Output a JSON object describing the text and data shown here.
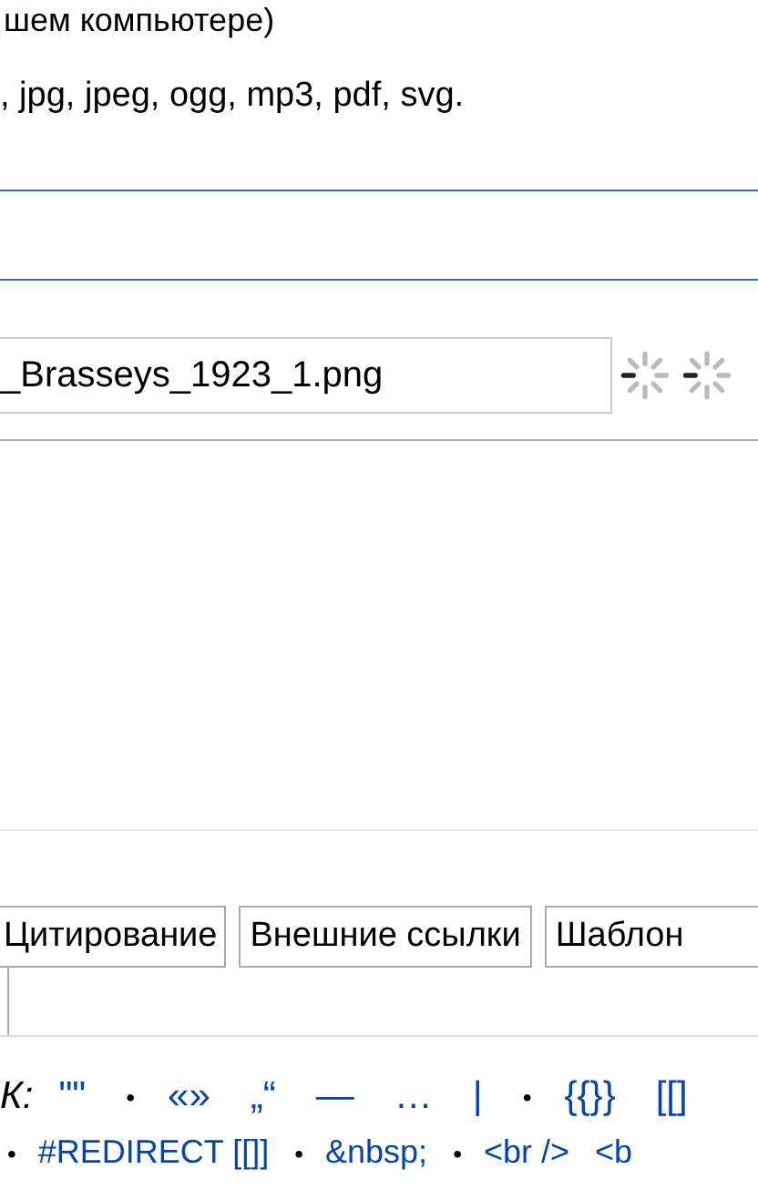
{
  "intro_lines": [
    "шем компьютере)",
    ", jpg, jpeg, ogg, mp3, pdf, svg."
  ],
  "filename_field": {
    "value": "_Brasseys_1923_1.png"
  },
  "toolbar_tabs": [
    "Цитирование",
    "Внешние ссылки",
    "Шаблон"
  ],
  "specialchars_label": "К:",
  "specialchars": [
    {
      "kind": "link",
      "text": "\"\""
    },
    {
      "kind": "bullet",
      "text": "•"
    },
    {
      "kind": "link",
      "text": "«»"
    },
    {
      "kind": "link",
      "text": "„“"
    },
    {
      "kind": "link",
      "text": "—"
    },
    {
      "kind": "link",
      "text": "…"
    },
    {
      "kind": "link",
      "text": "|"
    },
    {
      "kind": "bullet",
      "text": "•"
    },
    {
      "kind": "link",
      "text": "{{}}"
    },
    {
      "kind": "link",
      "text": "[[]"
    }
  ],
  "markup_items": [
    {
      "kind": "bullet",
      "text": "•"
    },
    {
      "kind": "link",
      "text": "#REDIRECT [[]]"
    },
    {
      "kind": "bullet",
      "text": "•"
    },
    {
      "kind": "link",
      "text": "&nbsp;"
    },
    {
      "kind": "bullet",
      "text": "•"
    },
    {
      "kind": "link",
      "text": "<br />"
    },
    {
      "kind": "link",
      "text": "<b"
    }
  ]
}
